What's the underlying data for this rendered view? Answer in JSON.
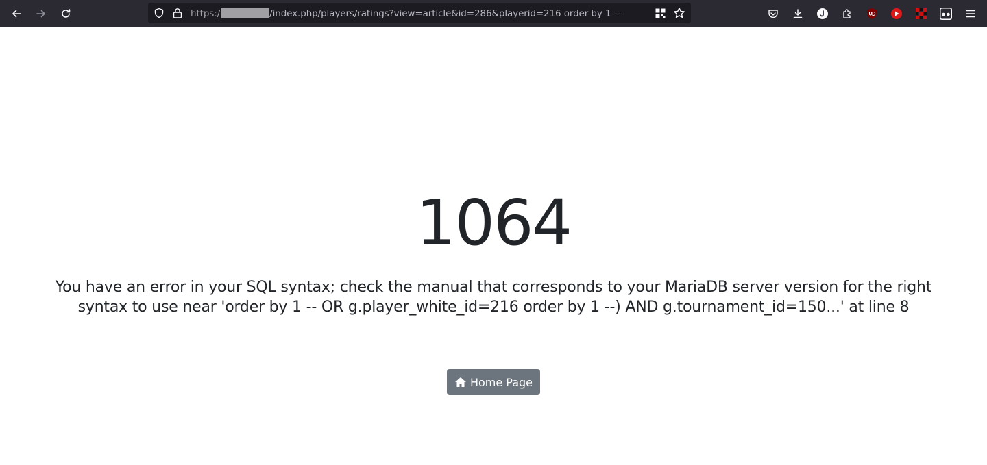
{
  "browser": {
    "url": {
      "protocol": "https:/",
      "path": "/index.php/players/ratings?view=article&id=286&playerid=216 order by 1 --"
    }
  },
  "page": {
    "error_code": "1064",
    "error_message": "You have an error in your SQL syntax; check the manual that corresponds to your MariaDB server version for the right syntax to use near 'order by 1 -- OR g.player_white_id=216 order by 1 --) AND g.tournament_id=150...' at line 8",
    "home_button_label": "Home Page"
  },
  "colors": {
    "toolbar_bg": "#2b2a33",
    "urlbar_bg": "#1c1b22",
    "button_bg": "#6c757d",
    "text": "#212529"
  }
}
